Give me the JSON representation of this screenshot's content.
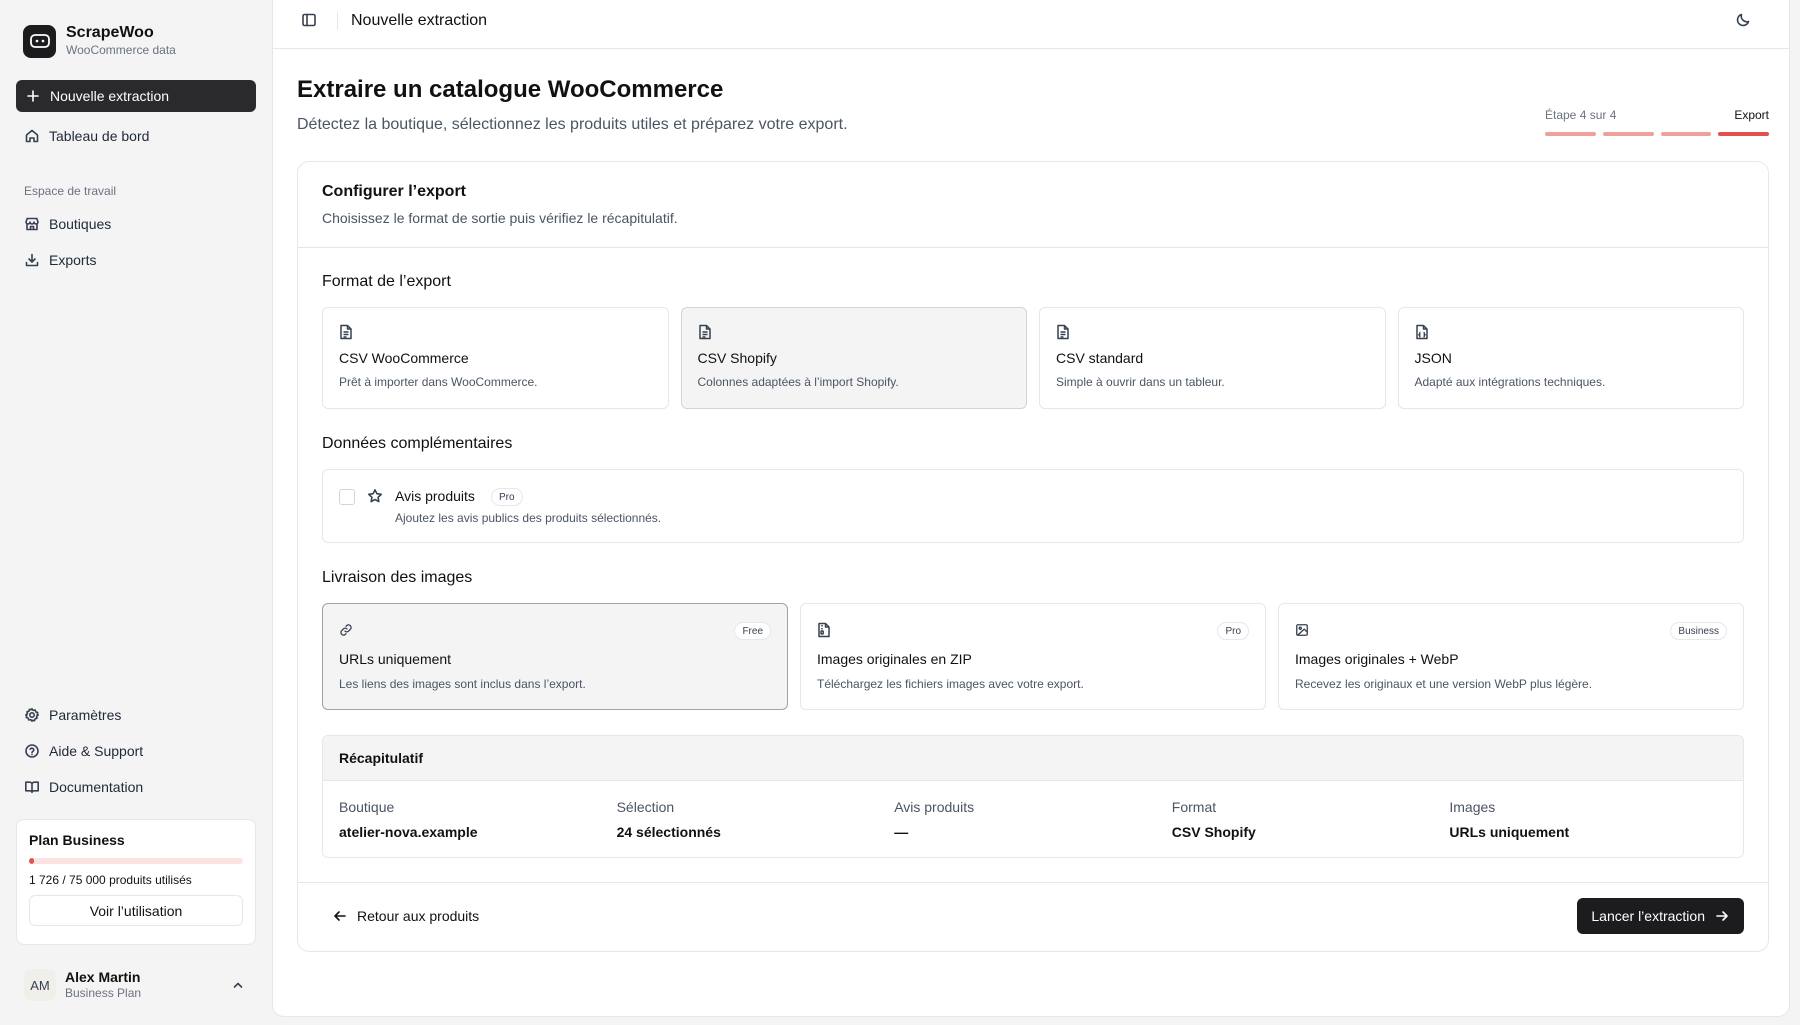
{
  "sidebar": {
    "brand_name": "ScrapeWoo",
    "brand_sub": "WooCommerce data",
    "new_extraction": "Nouvelle extraction",
    "dashboard": "Tableau de bord",
    "workspace_section": "Espace de travail",
    "shops": "Boutiques",
    "exports": "Exports",
    "settings": "Paramètres",
    "help": "Aide & Support",
    "docs": "Documentation",
    "plan": {
      "title": "Plan Business",
      "usage_text": "1 726 / 75 000 produits utilisés",
      "used": 1726,
      "limit": 75000,
      "button": "Voir l’utilisation"
    },
    "user": {
      "initials": "AM",
      "name": "Alex Martin",
      "plan": "Business Plan"
    }
  },
  "topbar": {
    "title": "Nouvelle extraction"
  },
  "page": {
    "title": "Extraire un catalogue WooCommerce",
    "subtitle": "Détectez la boutique, sélectionnez les produits utiles et préparez votre export.",
    "step_text": "Étape 4 sur 4",
    "step_current": "Export",
    "step_total": 4,
    "step_index": 4
  },
  "card": {
    "title": "Configurer l’export",
    "subtitle": "Choisissez le format de sortie puis vérifiez le récapitulatif.",
    "format_section": "Format de l’export",
    "formats": [
      {
        "title": "CSV WooCommerce",
        "desc": "Prêt à importer dans WooCommerce.",
        "selected": false
      },
      {
        "title": "CSV Shopify",
        "desc": "Colonnes adaptées à l’import Shopify.",
        "selected": true
      },
      {
        "title": "CSV standard",
        "desc": "Simple à ouvrir dans un tableur.",
        "selected": false
      },
      {
        "title": "JSON",
        "desc": "Adapté aux intégrations techniques.",
        "selected": false
      }
    ],
    "extra_section": "Données complémentaires",
    "reviews": {
      "title": "Avis produits",
      "badge": "Pro",
      "desc": "Ajoutez les avis publics des produits sélectionnés.",
      "checked": false
    },
    "images_section": "Livraison des images",
    "image_options": [
      {
        "title": "URLs uniquement",
        "desc": "Les liens des images sont inclus dans l’export.",
        "badge": "Free",
        "icon": "link-icon",
        "selected": true
      },
      {
        "title": "Images originales en ZIP",
        "desc": "Téléchargez les fichiers images avec votre export.",
        "badge": "Pro",
        "icon": "file-archive-icon",
        "selected": false
      },
      {
        "title": "Images originales + WebP",
        "desc": "Recevez les originaux et une version WebP plus légère.",
        "badge": "Business",
        "icon": "image-icon",
        "selected": false
      }
    ],
    "summary": {
      "title": "Récapitulatif",
      "items": [
        {
          "label": "Boutique",
          "value": "atelier-nova.example"
        },
        {
          "label": "Sélection",
          "value": "24 sélectionnés"
        },
        {
          "label": "Avis produits",
          "value": "—"
        },
        {
          "label": "Format",
          "value": "CSV Shopify"
        },
        {
          "label": "Images",
          "value": "URLs uniquement"
        }
      ]
    },
    "back_label": "Retour aux produits",
    "launch_label": "Lancer l’extraction"
  },
  "colors": {
    "accent": "#e0524b",
    "accent_light": "#f0a09b",
    "dark": "#1c1c1e"
  }
}
